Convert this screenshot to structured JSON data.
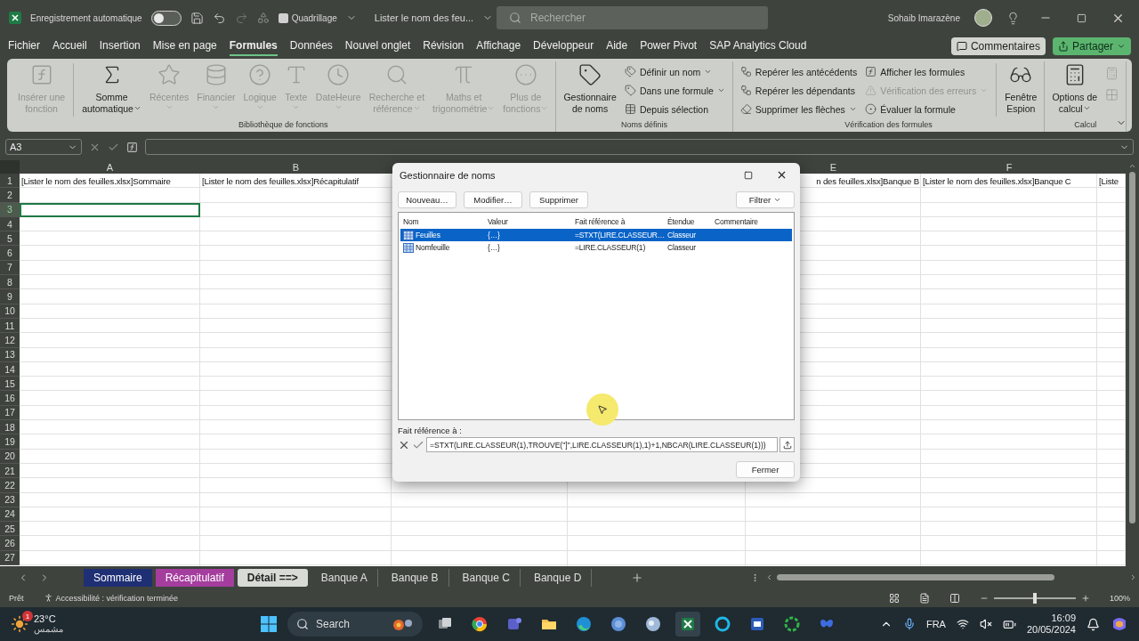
{
  "title_bar": {
    "autosave_label": "Enregistrement automatique",
    "autosave_on": false,
    "gridlines_label": "Quadrillage",
    "gridlines_checked": false,
    "document_title": "Lister le nom des feu...",
    "search_placeholder": "Rechercher",
    "user_name": "Sohaib Imarazène"
  },
  "ribbon_tabs": [
    {
      "label": "Fichier",
      "selected": false
    },
    {
      "label": "Accueil",
      "selected": false
    },
    {
      "label": "Insertion",
      "selected": false
    },
    {
      "label": "Mise en page",
      "selected": false
    },
    {
      "label": "Formules",
      "selected": true
    },
    {
      "label": "Données",
      "selected": false
    },
    {
      "label": "Nouvel onglet",
      "selected": false
    },
    {
      "label": "Révision",
      "selected": false
    },
    {
      "label": "Affichage",
      "selected": false
    },
    {
      "label": "Développeur",
      "selected": false
    },
    {
      "label": "Aide",
      "selected": false
    },
    {
      "label": "Power Pivot",
      "selected": false
    },
    {
      "label": "SAP Analytics Cloud",
      "selected": false
    }
  ],
  "comments_button": "Commentaires",
  "share_button": "Partager",
  "ribbon_groups": [
    {
      "title": "Bibliothèque de fonctions",
      "items": [
        {
          "kind": "large",
          "label": "Insérer une\nfonction",
          "disabled": true,
          "dropdown": false
        },
        {
          "kind": "separator"
        },
        {
          "kind": "large",
          "label": "Somme\nautomatique",
          "disabled": false,
          "dropdown": true
        },
        {
          "kind": "large",
          "label": "Récentes",
          "disabled": true,
          "dropdown": true
        },
        {
          "kind": "large",
          "label": "Financier",
          "disabled": true,
          "dropdown": true
        },
        {
          "kind": "large",
          "label": "Logique",
          "disabled": true,
          "dropdown": true
        },
        {
          "kind": "large",
          "label": "Texte",
          "disabled": true,
          "dropdown": true
        },
        {
          "kind": "large",
          "label": "DateHeure",
          "disabled": true,
          "dropdown": true
        },
        {
          "kind": "large",
          "label": "Recherche et\nréférence",
          "disabled": true,
          "dropdown": true
        },
        {
          "kind": "large",
          "label": "Maths et\ntrigonométrie",
          "disabled": true,
          "dropdown": true
        },
        {
          "kind": "large",
          "label": "Plus de\nfonctions",
          "disabled": true,
          "dropdown": true
        }
      ]
    },
    {
      "title": "Noms définis",
      "items": [
        {
          "kind": "large",
          "label": "Gestionnaire\nde noms",
          "disabled": false,
          "dropdown": false
        },
        {
          "kind": "small",
          "label": "Définir un nom",
          "disabled": false,
          "dropdown": true
        },
        {
          "kind": "small",
          "label": "Dans une formule",
          "disabled": false,
          "dropdown": true
        },
        {
          "kind": "small",
          "label": "Depuis sélection",
          "disabled": false,
          "dropdown": false
        }
      ]
    },
    {
      "title": "Vérification des formules",
      "items": [
        {
          "kind": "small",
          "label": "Repérer les antécédents",
          "disabled": false,
          "dropdown": false
        },
        {
          "kind": "small",
          "label": "Repérer les dépendants",
          "disabled": false,
          "dropdown": false
        },
        {
          "kind": "small",
          "label": "Supprimer les flèches",
          "disabled": false,
          "dropdown": true
        },
        {
          "kind": "small",
          "label": "Afficher les formules",
          "disabled": false,
          "dropdown": false
        },
        {
          "kind": "small",
          "label": "Vérification des erreurs",
          "disabled": true,
          "dropdown": true
        },
        {
          "kind": "small",
          "label": "Évaluer la formule",
          "disabled": false,
          "dropdown": false
        },
        {
          "kind": "separator"
        },
        {
          "kind": "large",
          "label": "Fenêtre\nEspion",
          "disabled": false,
          "dropdown": false
        }
      ]
    },
    {
      "title": "Calcul",
      "items": [
        {
          "kind": "large",
          "label": "Options de\ncalcul",
          "disabled": false,
          "dropdown": true
        },
        {
          "kind": "icon",
          "disabled": true
        },
        {
          "kind": "icon",
          "disabled": true
        }
      ]
    }
  ],
  "formula_bar": {
    "name_box": "A3"
  },
  "sheet": {
    "columns": [
      "A",
      "B",
      "E",
      "F"
    ],
    "row1_cells": [
      "[Lister le nom des feuilles.xlsx]Sommaire",
      "[Lister le nom des feuilles.xlsx]Récapitulatif",
      "n des feuilles.xlsx]Banque B",
      "[Lister le nom des feuilles.xlsx]Banque C",
      "[Liste"
    ],
    "rows": [
      {
        "label": "1",
        "selected": false
      },
      {
        "label": "2",
        "selected": false
      },
      {
        "label": "3",
        "selected": true
      },
      {
        "label": "4",
        "selected": false
      },
      {
        "label": "5",
        "selected": false
      },
      {
        "label": "6",
        "selected": false
      },
      {
        "label": "7",
        "selected": false
      },
      {
        "label": "8",
        "selected": false
      },
      {
        "label": "9",
        "selected": false
      },
      {
        "label": "10",
        "selected": false
      },
      {
        "label": "11",
        "selected": false
      },
      {
        "label": "12",
        "selected": false
      },
      {
        "label": "13",
        "selected": false
      },
      {
        "label": "14",
        "selected": false
      },
      {
        "label": "15",
        "selected": false
      },
      {
        "label": "16",
        "selected": false
      },
      {
        "label": "17",
        "selected": false
      },
      {
        "label": "18",
        "selected": false
      },
      {
        "label": "19",
        "selected": false
      },
      {
        "label": "20",
        "selected": false
      },
      {
        "label": "21",
        "selected": false
      },
      {
        "label": "22",
        "selected": false
      },
      {
        "label": "23",
        "selected": false
      },
      {
        "label": "24",
        "selected": false
      },
      {
        "label": "25",
        "selected": false
      },
      {
        "label": "26",
        "selected": false
      },
      {
        "label": "27",
        "selected": false
      }
    ]
  },
  "sheet_tabs": [
    {
      "label": "Sommaire",
      "selected": false,
      "color": "#1f2f74"
    },
    {
      "label": "Récapitulatif",
      "selected": false,
      "color": "#a43d9d"
    },
    {
      "label": "Détail ==>",
      "selected": true
    },
    {
      "label": "Banque A",
      "selected": false
    },
    {
      "label": "Banque B",
      "selected": false
    },
    {
      "label": "Banque C",
      "selected": false
    },
    {
      "label": "Banque D",
      "selected": false
    }
  ],
  "status_bar": {
    "ready": "Prêt",
    "accessibility": "Accessibilité : vérification terminée",
    "zoom": "100%",
    "zoom_slider": {
      "level": 0.5
    }
  },
  "name_manager": {
    "title": "Gestionnaire de noms",
    "buttons": [
      "Nouveau…",
      "Modifier…",
      "Supprimer"
    ],
    "filter_button": "Filtrer",
    "columns": [
      "Nom",
      "Valeur",
      "Fait référence à",
      "Étendue",
      "Commentaire"
    ],
    "rows": [
      {
        "name": "Feuilles",
        "value": "{…}",
        "refers_to": "=STXT(LIRE.CLASSEUR…",
        "scope": "Classeur",
        "selected": true
      },
      {
        "name": "Nomfeuille",
        "value": "{…}",
        "refers_to": "=LIRE.CLASSEUR(1)",
        "scope": "Classeur",
        "selected": false
      }
    ],
    "refers_label": "Fait référence à :",
    "refers_value": "=STXT(LIRE.CLASSEUR(1),TROUVE(\"]\",LIRE.CLASSEUR(1),1)+1,NBCAR(LIRE.CLASSEUR(1)))",
    "close_button": "Fermer"
  },
  "taskbar": {
    "badge": "1",
    "temperature": "23°C",
    "weather": "مشمس",
    "search": "Search",
    "language": "FRA",
    "time": "16:09",
    "date": "20/05/2024"
  }
}
